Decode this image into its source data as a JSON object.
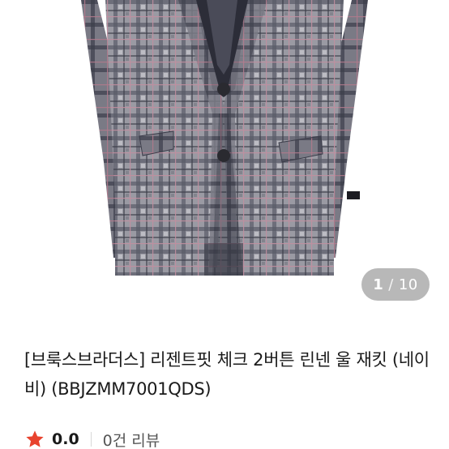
{
  "product": {
    "image_alt": "check blazer jacket",
    "image_counter": {
      "current": "1",
      "separator": "/",
      "total": "10"
    },
    "title": "[브룩스브라더스] 리젠트핏 체크 2버튼 린넨 울 재킷 (네이비) (BBJZMM7001QDS)"
  },
  "rating": {
    "star_icon": "star-icon",
    "value": "0.0",
    "review_count": "0건 리뷰"
  },
  "colors": {
    "star": "#e8432e",
    "fabric_base": "#8a8a94",
    "fabric_dark": "#3c3d4a",
    "fabric_accent": "#b07a8c"
  }
}
